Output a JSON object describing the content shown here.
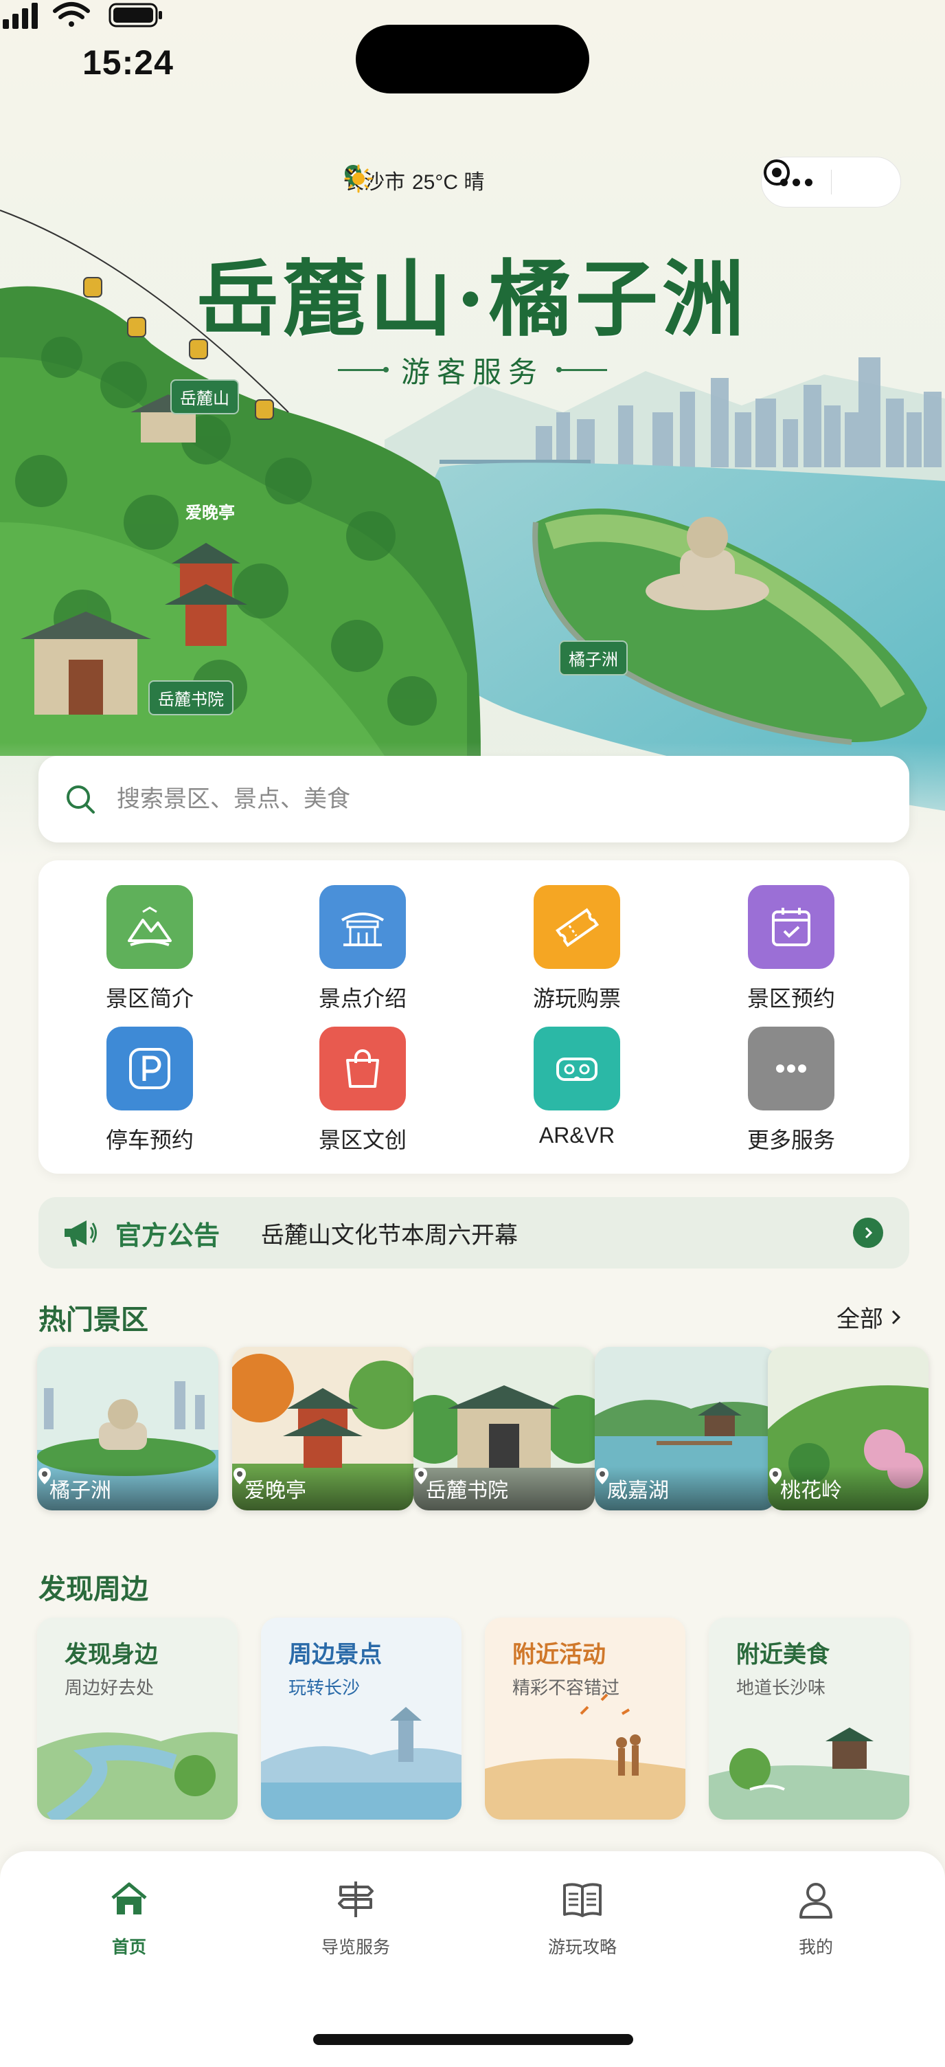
{
  "status_bar": {
    "time": "15:24"
  },
  "header": {
    "city": "长沙市",
    "weather": "25°C  晴",
    "title": "岳麓山·橘子洲",
    "subtitle": "游客服务"
  },
  "map_labels": {
    "yuelu_mountain": "岳麓山",
    "aiwan_pavilion": "爱晚亭",
    "academy": "岳麓书院",
    "orange_isle": "橘子洲"
  },
  "search": {
    "placeholder": "搜索景区、景点、美食"
  },
  "services": [
    {
      "label": "景区简介",
      "icon": "mountain-icon",
      "color": "#5fb05a"
    },
    {
      "label": "景点介绍",
      "icon": "pavilion-icon",
      "color": "#4a90d9"
    },
    {
      "label": "游玩购票",
      "icon": "ticket-icon",
      "color": "#f5a623"
    },
    {
      "label": "景区预约",
      "icon": "calendar-icon",
      "color": "#9b6fd6"
    },
    {
      "label": "停车预约",
      "icon": "parking-icon",
      "color": "#3e8ad6"
    },
    {
      "label": "景区文创",
      "icon": "shopping-bag-icon",
      "color": "#e85a4f"
    },
    {
      "label": "AR&VR",
      "icon": "vr-headset-icon",
      "color": "#2bb8a6"
    },
    {
      "label": "更多服务",
      "icon": "more-icon",
      "color": "#8a8a8a"
    }
  ],
  "notice": {
    "tag": "官方公告",
    "message": "岳麓山文化节本周六开幕"
  },
  "hot_spots": {
    "title": "热门景区",
    "more": "全部",
    "items": [
      "橘子洲",
      "爱晚亭",
      "岳麓书院",
      "威嘉湖",
      "桃花岭"
    ]
  },
  "nearby": {
    "title": "发现周边",
    "items": [
      {
        "title": "发现身边",
        "sub": "周边好去处",
        "color": "#2a6a3c"
      },
      {
        "title": "周边景点",
        "sub": "玩转长沙",
        "color": "#2a6aa8"
      },
      {
        "title": "附近活动",
        "sub": "精彩不容错过",
        "color": "#d0782a"
      },
      {
        "title": "附近美食",
        "sub": "地道长沙味",
        "color": "#2a6a3c"
      }
    ]
  },
  "tabbar": [
    {
      "label": "首页",
      "icon": "home-icon",
      "active": true
    },
    {
      "label": "导览服务",
      "icon": "signpost-icon",
      "active": false
    },
    {
      "label": "游玩攻略",
      "icon": "book-icon",
      "active": false
    },
    {
      "label": "我的",
      "icon": "user-icon",
      "active": false
    }
  ]
}
